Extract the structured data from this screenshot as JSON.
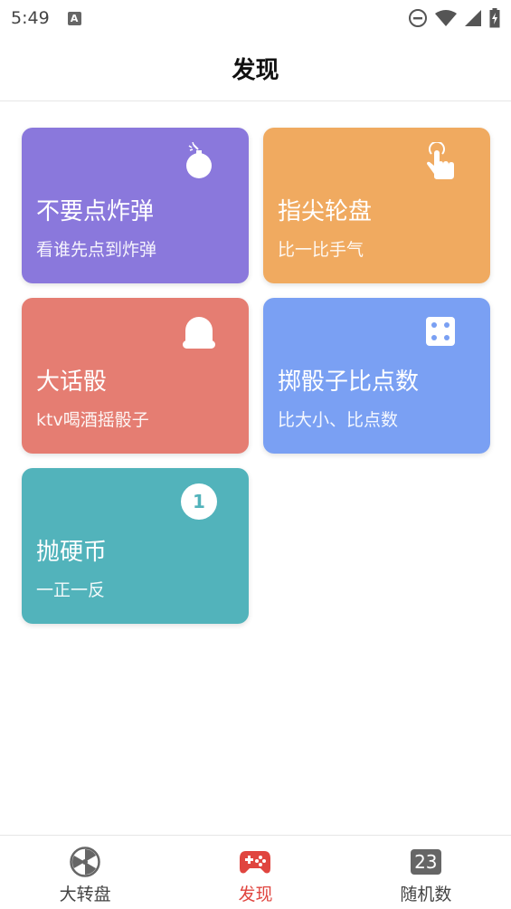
{
  "status": {
    "time": "5:49",
    "a_icon": "A"
  },
  "header": {
    "title": "发现"
  },
  "cards": [
    {
      "title": "不要点炸弹",
      "subtitle": "看谁先点到炸弹",
      "icon": "bomb-icon",
      "color": "#8a78dc"
    },
    {
      "title": "指尖轮盘",
      "subtitle": "比一比手气",
      "icon": "pointing-hand-icon",
      "color": "#f0aa60"
    },
    {
      "title": "大话骰",
      "subtitle": "ktv喝酒摇骰子",
      "icon": "dice-cup-icon",
      "color": "#e57d72"
    },
    {
      "title": "掷骰子比点数",
      "subtitle": "比大小、比点数",
      "icon": "dice-icon",
      "color": "#7aa0f3"
    },
    {
      "title": "抛硬币",
      "subtitle": "一正一反",
      "icon": "coin-icon",
      "color": "#52b3bb"
    }
  ],
  "nav": {
    "items": [
      {
        "label": "大转盘",
        "icon": "wheel-icon"
      },
      {
        "label": "发现",
        "icon": "gamepad-icon"
      },
      {
        "label": "随机数",
        "icon": "random-number-icon",
        "badge": "23"
      }
    ],
    "active_color": "#e0453f"
  },
  "coin_face": "1"
}
